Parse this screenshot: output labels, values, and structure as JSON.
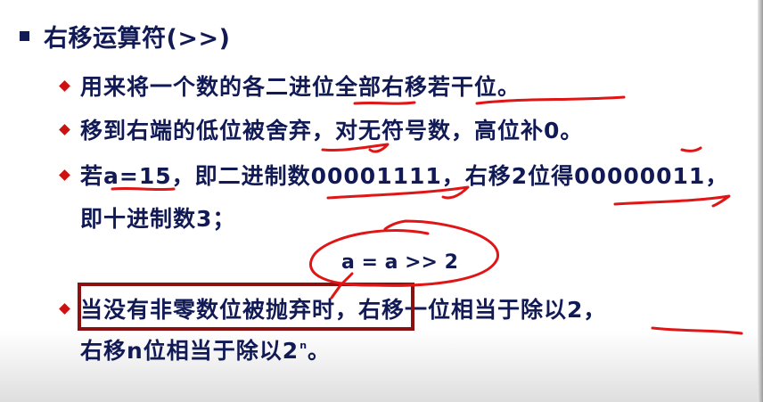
{
  "slide": {
    "title": "右移运算符(>>)",
    "lines": [
      "用来将一个数的各二进位全部右移若干位。",
      "移到右端的低位被舍弃，对无符号数，高位补0。",
      "若a=15，即二进制数00001111，右移2位得00000011，",
      "即十进制数3；",
      "a = a >> 2",
      "当没有非零数位被抛弃时，右移一位相当于除以2，",
      "右移n位相当于除以2",
      "n",
      "。"
    ]
  },
  "colors": {
    "text": "#111a55",
    "bullet": "#cc1111",
    "annotation": "#e01515",
    "highlight_box": "#8b1010"
  }
}
